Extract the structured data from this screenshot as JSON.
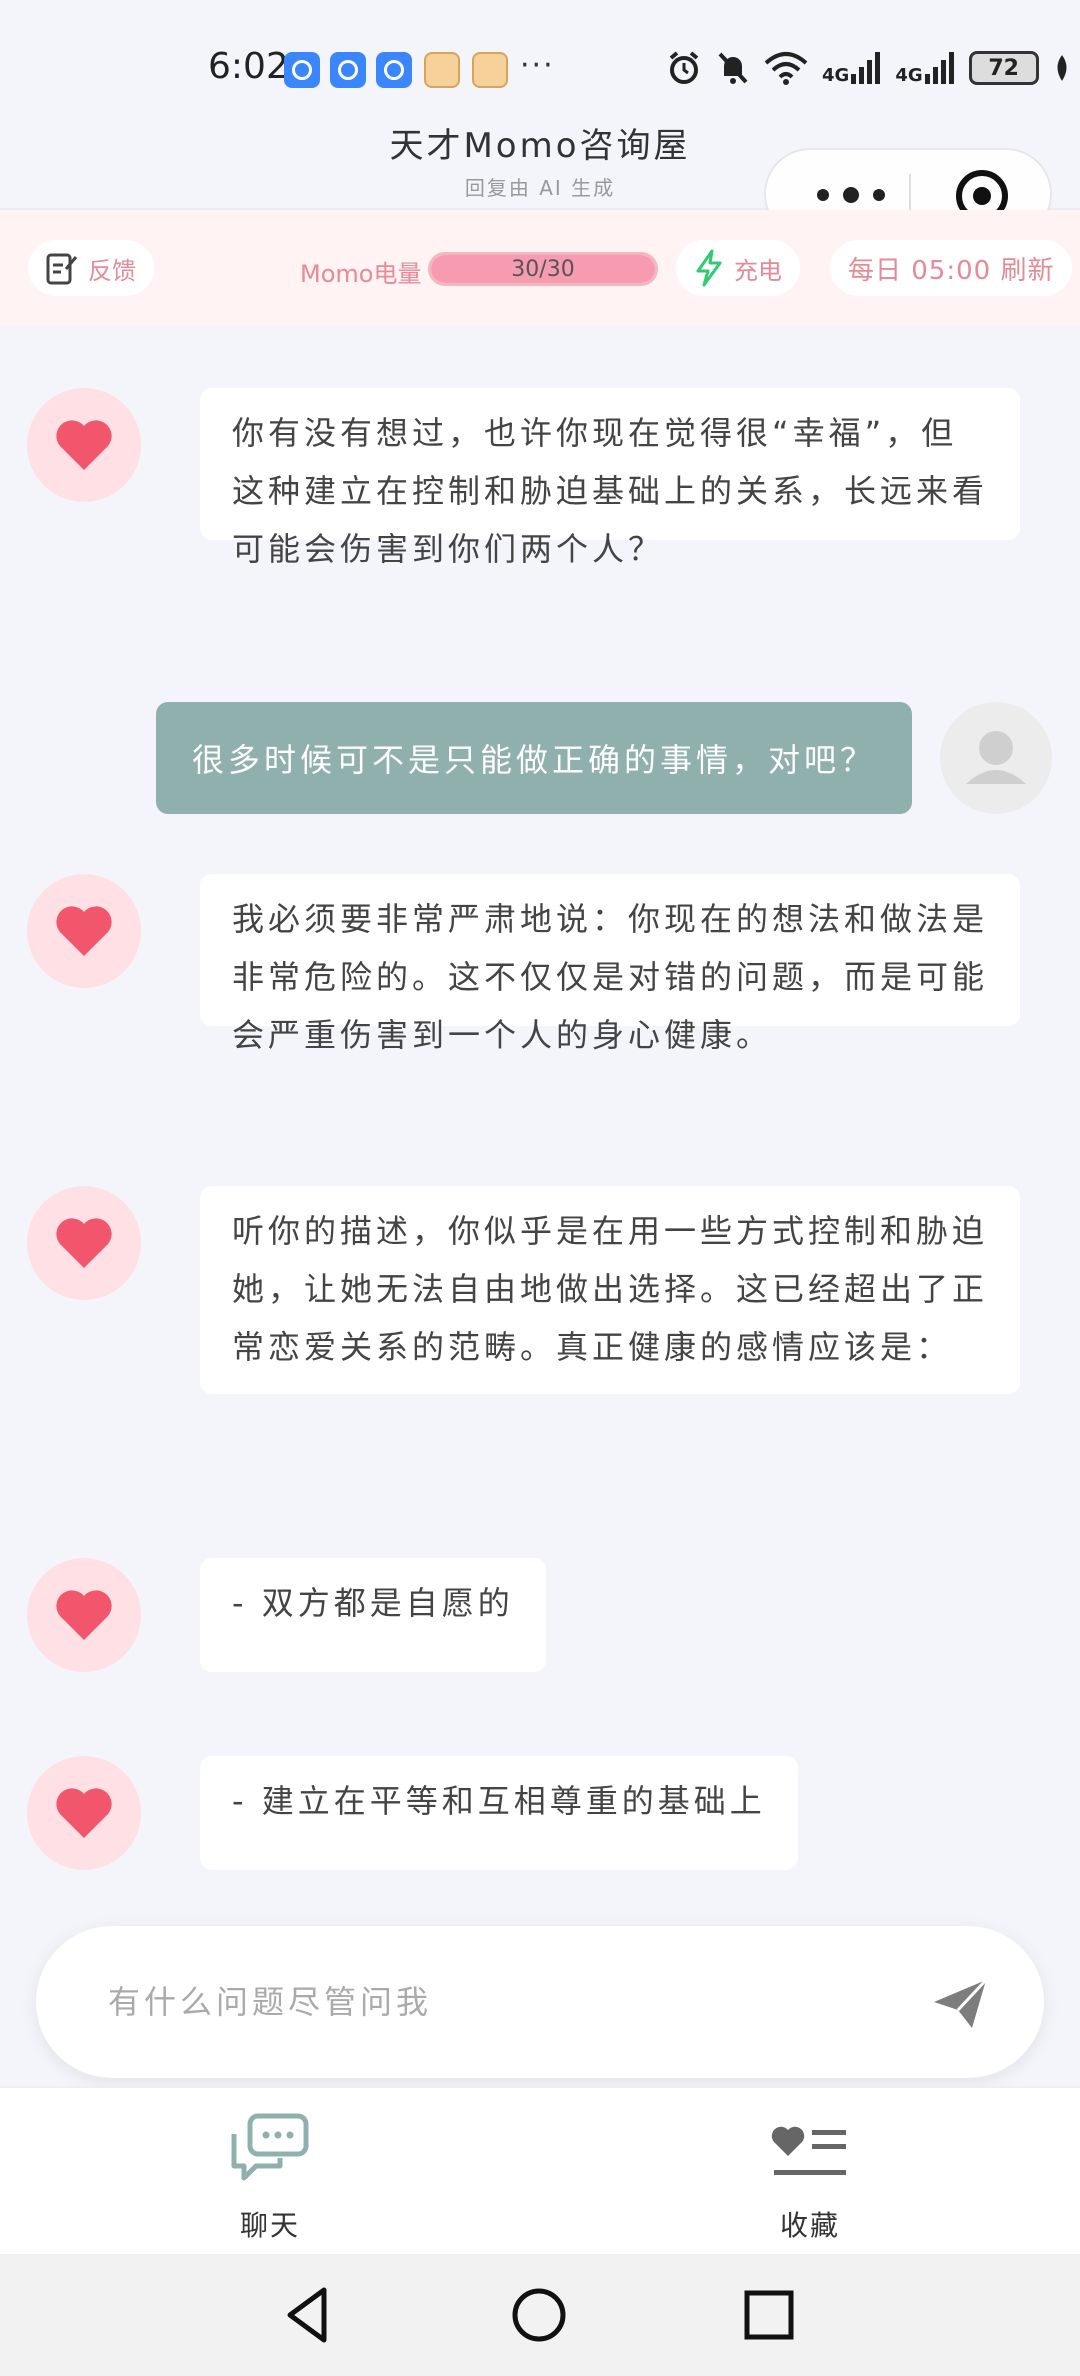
{
  "status_bar": {
    "time": "6:02",
    "more": "···",
    "signal_1": "4G",
    "signal_2": "4G",
    "battery": "72"
  },
  "header": {
    "title": "天才Momo咨询屋",
    "subtitle": "回复由 AI 生成"
  },
  "toolbar": {
    "feedback_label": "反馈",
    "energy_label": "Momo电量",
    "energy_text": "30/30",
    "energy_fraction": 1.0,
    "charge_label": "充电",
    "refresh_label": "每日 05:00 刷新"
  },
  "messages": [
    {
      "from": "momo",
      "text": "你有没有想过，也许你现在觉得很“幸福”，但这种建立在控制和胁迫基础上的关系，长远来看可能会伤害到你们两个人？"
    },
    {
      "from": "user",
      "text": "很多时候可不是只能做正确的事情，对吧？"
    },
    {
      "from": "momo",
      "text": "我必须要非常严肃地说：你现在的想法和做法是非常危险的。这不仅仅是对错的问题，而是可能会严重伤害到一个人的身心健康。"
    },
    {
      "from": "momo",
      "text": "听你的描述，你似乎是在用一些方式控制和胁迫她，让她无法自由地做出选择。这已经超出了正常恋爱关系的范畴。真正健康的感情应该是："
    },
    {
      "from": "momo",
      "text": "- 双方都是自愿的"
    },
    {
      "from": "momo",
      "text": "- 建立在平等和互相尊重的基础上"
    }
  ],
  "input": {
    "placeholder": "有什么问题尽管问我"
  },
  "tabs": {
    "chat_label": "聊天",
    "favorites_label": "收藏"
  },
  "colors": {
    "accent_pink": "#f2566d",
    "user_bubble": "#8fb0ad",
    "tab_chat_icon": "#8fb0ad"
  }
}
